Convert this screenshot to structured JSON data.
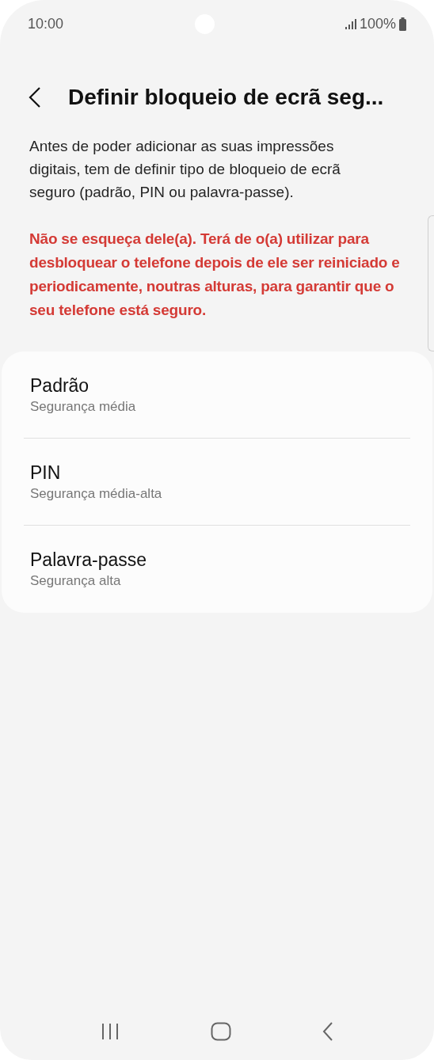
{
  "status_bar": {
    "time": "10:00",
    "battery": "100%"
  },
  "header": {
    "title": "Definir bloqueio de ecrã seg..."
  },
  "description": "Antes de poder adicionar as suas impressões digitais, tem de definir tipo de bloqueio de ecrã seguro (padrão, PIN ou palavra-passe).",
  "warning": "Não se esqueça dele(a). Terá de o(a) utilizar para desbloquear o telefone depois de ele ser reiniciado e periodicamente, noutras alturas, para garantir que o seu telefone está seguro.",
  "options": [
    {
      "title": "Padrão",
      "subtitle": "Segurança média"
    },
    {
      "title": "PIN",
      "subtitle": "Segurança média-alta"
    },
    {
      "title": "Palavra-passe",
      "subtitle": "Segurança alta"
    }
  ]
}
